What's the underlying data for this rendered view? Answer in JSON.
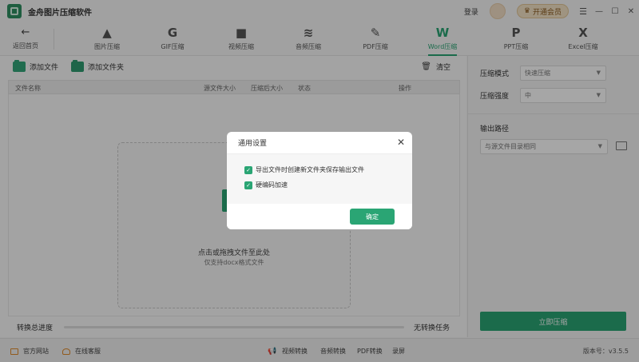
{
  "app": {
    "title": "金舟图片压缩软件"
  },
  "titlebar": {
    "login": "登录",
    "vip": "开通会员"
  },
  "toolbar": {
    "back": "返回首页",
    "tools": [
      {
        "label": "图片压缩",
        "icon": "image-compress-icon"
      },
      {
        "label": "GIF压缩",
        "icon": "gif-compress-icon"
      },
      {
        "label": "视频压缩",
        "icon": "video-compress-icon"
      },
      {
        "label": "音频压缩",
        "icon": "audio-compress-icon"
      },
      {
        "label": "PDF压缩",
        "icon": "pdf-compress-icon"
      },
      {
        "label": "Word压缩",
        "icon": "word-compress-icon",
        "active": true
      },
      {
        "label": "PPT压缩",
        "icon": "ppt-compress-icon"
      },
      {
        "label": "Excel压缩",
        "icon": "excel-compress-icon"
      }
    ]
  },
  "files": {
    "add_file": "添加文件",
    "add_folder": "添加文件夹",
    "clear": "清空",
    "columns": [
      "文件名称",
      "源文件大小",
      "压缩后大小",
      "状态",
      "操作"
    ],
    "drop_main": "点击或拖拽文件至此处",
    "drop_sub": "仅支持docx格式文件"
  },
  "progress": {
    "label": "转换总进度",
    "status": "无转换任务",
    "fraction": 0
  },
  "settings": {
    "mode_label": "压缩模式",
    "mode_value": "快速压缩",
    "strength_label": "压缩强度",
    "strength_value": "中",
    "output_label": "输出路径",
    "output_value": "与源文件目录相同",
    "compress_button": "立即压缩"
  },
  "statusbar": {
    "website": "官方网站",
    "service": "在线客服",
    "links": [
      "视频转换",
      "音频转换",
      "PDF转换",
      "录屏"
    ],
    "version": "版本号：v3.5.5"
  },
  "dialog": {
    "title": "通用设置",
    "options": [
      {
        "label": "导出文件时创建新文件夹保存输出文件",
        "checked": true
      },
      {
        "label": "硬编码加速",
        "checked": true
      }
    ],
    "ok": "确定"
  },
  "colors": {
    "accent": "#2aa574",
    "vip": "#f4e3c7"
  }
}
